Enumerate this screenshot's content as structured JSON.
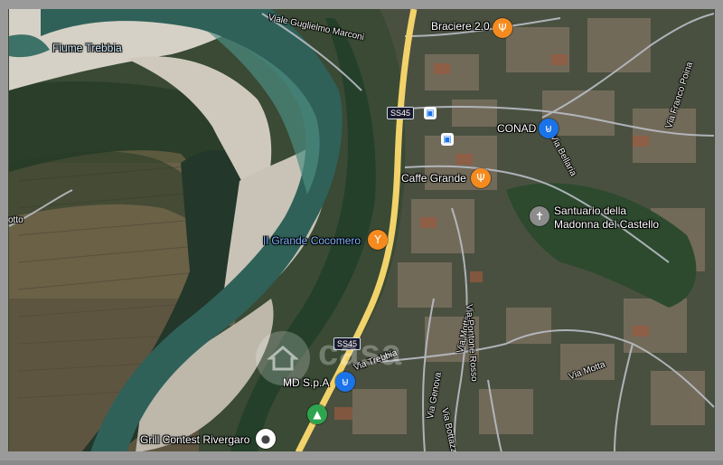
{
  "map": {
    "colors": {
      "river": "#2e5e57",
      "river_light": "#5fa59a",
      "gravel": "#cfcac0",
      "field": "#5a5a3c",
      "forest": "#24402a",
      "town": "#6d6a60",
      "main_road": "#f2d36b",
      "side_road": "#b9bec6"
    },
    "river_label": "Fiume Trebbia",
    "streets": {
      "marconi": "Viale Guglielmo Marconi",
      "franco_poina": "Via Franco Poina",
      "bellaria": "Via Bellaria",
      "motta_1": "Via Motta",
      "pontone_rosso": "Via Pontone Rosso",
      "trebbia": "Via Trebbia",
      "genova": "Via Genova",
      "bottazzi": "Via Bottazzi",
      "motta_2": "Via Motta",
      "left_edge": "otto"
    },
    "road_shields": {
      "ss45_top": "SS45",
      "ss45_bottom": "SS45"
    },
    "pois": {
      "braciere": {
        "name": "Braciere 2.0",
        "icon": "restaurant-icon"
      },
      "conad": {
        "name": "CONAD",
        "icon": "shopping-cart-icon"
      },
      "caffe": {
        "name": "Caffe Grande",
        "icon": "restaurant-icon"
      },
      "santuario": {
        "name": "Santuario della\nMadonna del Castello",
        "line1": "Santuario della",
        "line2": "Madonna del Castello",
        "icon": "church-cross-icon"
      },
      "cocomero": {
        "name": "Il Grande Cocomero",
        "icon": "cocktail-bar-icon"
      },
      "md": {
        "name": "MD S.p.A",
        "icon": "shopping-cart-icon"
      },
      "grill": {
        "name": "Grill Contest Rivergaro",
        "icon": "place-pin-icon"
      },
      "park": {
        "icon": "park-tree-icon"
      }
    },
    "watermark": "casa"
  }
}
